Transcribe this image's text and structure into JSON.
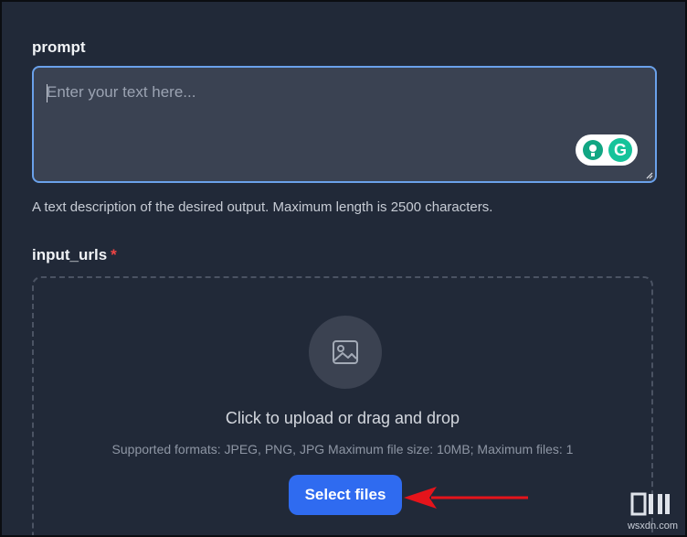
{
  "prompt_field": {
    "label": "prompt",
    "placeholder": "Enter your text here...",
    "value": "",
    "help_text": "A text description of the desired output. Maximum length is 2500 characters."
  },
  "grammarly": {
    "icons": [
      "lightbulb-icon",
      "grammarly-g-icon"
    ],
    "brand_color": "#15c39a",
    "letter": "G"
  },
  "input_urls_field": {
    "label": "input_urls",
    "required_mark": "*",
    "required_color": "#ef4444",
    "dropzone": {
      "icon": "image-icon",
      "title": "Click to upload or drag and drop",
      "subtitle": "Supported formats: JPEG, PNG, JPG Maximum file size: 10MB; Maximum files: 1",
      "button_label": "Select files",
      "button_color": "#2f6bf0"
    }
  },
  "annotation": {
    "arrow_color": "#e5141b",
    "arrow_points_to": "Select files"
  },
  "watermark": {
    "text": "wsxdn.com"
  }
}
